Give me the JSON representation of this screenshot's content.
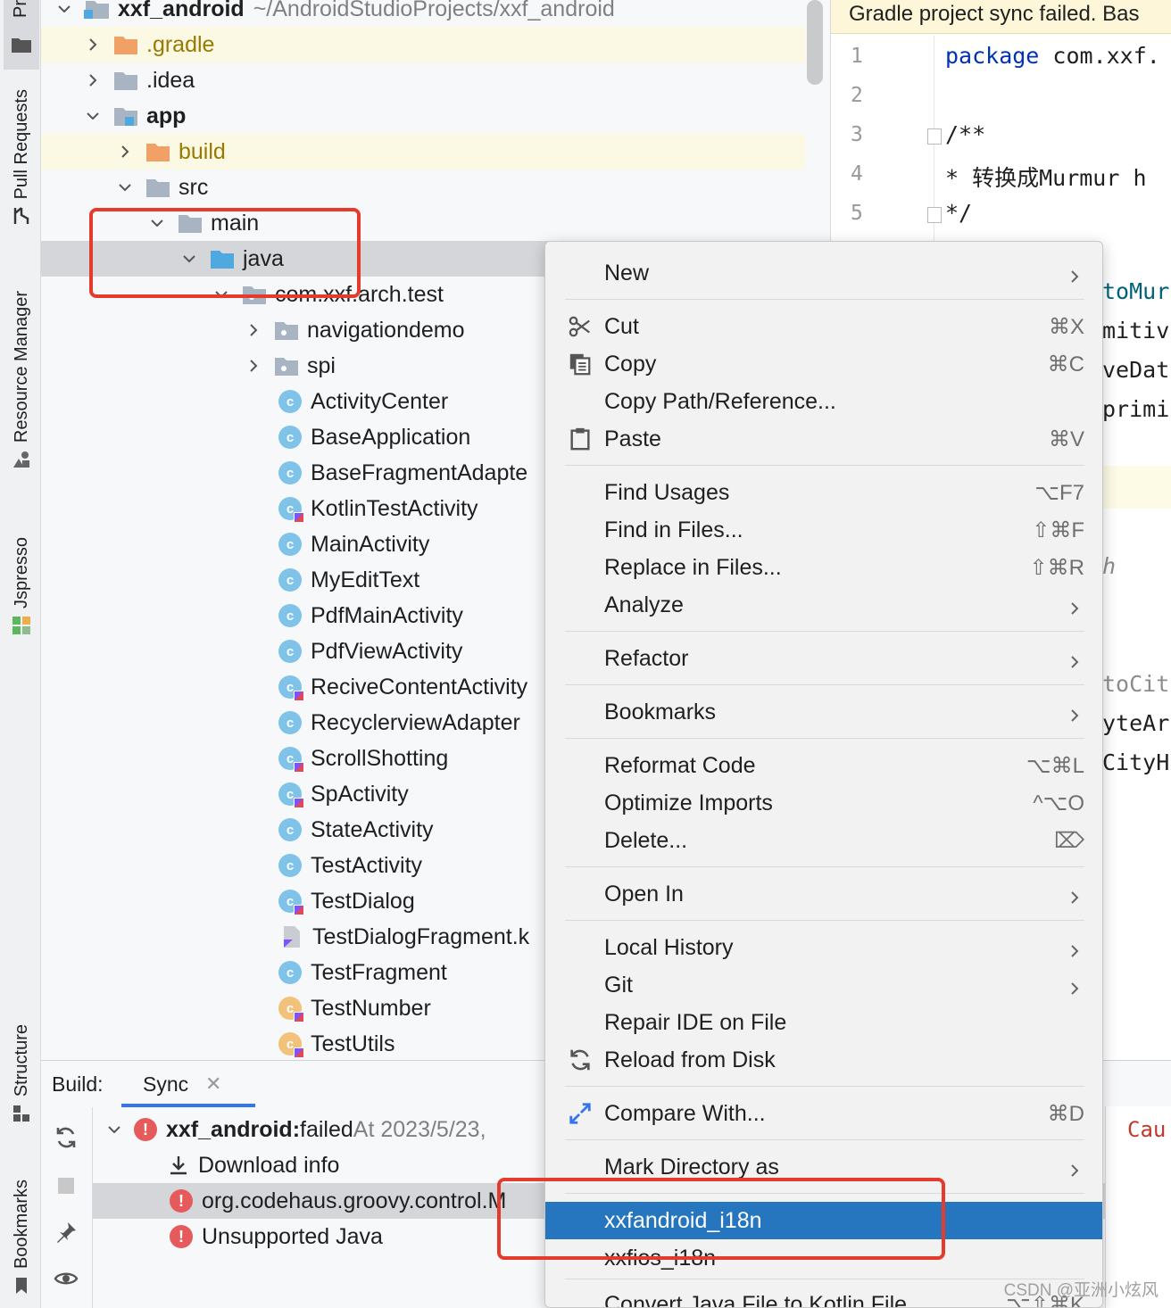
{
  "left_strip": {
    "project_label": "Pr",
    "pull_requests_label": "Pull Requests",
    "resource_manager_label": "Resource Manager",
    "jspresso_label": "Jspresso",
    "structure_label": "Structure",
    "bookmarks_label": "Bookmarks"
  },
  "tree": {
    "root": {
      "name": "xxf_android",
      "path": "~/AndroidStudioProjects/xxf_android"
    },
    "items": [
      {
        "label": ".gradle"
      },
      {
        "label": ".idea"
      },
      {
        "label": "app"
      },
      {
        "label": "build"
      },
      {
        "label": "src"
      },
      {
        "label": "main"
      },
      {
        "label": "java"
      },
      {
        "label": "com.xxf.arch.test"
      },
      {
        "label": "navigationdemo"
      },
      {
        "label": "spi"
      }
    ],
    "classes": [
      {
        "label": "ActivityCenter",
        "icon": "C",
        "kotlin": false,
        "orange": false
      },
      {
        "label": "BaseApplication",
        "icon": "C",
        "kotlin": false,
        "orange": false
      },
      {
        "label": "BaseFragmentAdapte",
        "icon": "C",
        "kotlin": false,
        "orange": false
      },
      {
        "label": "KotlinTestActivity",
        "icon": "C",
        "kotlin": true,
        "orange": false
      },
      {
        "label": "MainActivity",
        "icon": "C",
        "kotlin": false,
        "orange": false
      },
      {
        "label": "MyEditText",
        "icon": "C",
        "kotlin": false,
        "orange": false
      },
      {
        "label": "PdfMainActivity",
        "icon": "C",
        "kotlin": false,
        "orange": false
      },
      {
        "label": "PdfViewActivity",
        "icon": "C",
        "kotlin": false,
        "orange": false
      },
      {
        "label": "ReciveContentActivity",
        "icon": "C",
        "kotlin": true,
        "orange": false
      },
      {
        "label": "RecyclerviewAdapter",
        "icon": "C",
        "kotlin": false,
        "orange": false
      },
      {
        "label": "ScrollShotting",
        "icon": "C",
        "kotlin": true,
        "orange": false
      },
      {
        "label": "SpActivity",
        "icon": "C",
        "kotlin": true,
        "orange": false
      },
      {
        "label": "StateActivity",
        "icon": "C",
        "kotlin": false,
        "orange": false
      },
      {
        "label": "TestActivity",
        "icon": "C",
        "kotlin": false,
        "orange": false
      },
      {
        "label": "TestDialog",
        "icon": "C",
        "kotlin": true,
        "orange": false
      },
      {
        "label": "TestDialogFragment.k",
        "icon": "file",
        "kotlin": true,
        "orange": false
      },
      {
        "label": "TestFragment",
        "icon": "C",
        "kotlin": false,
        "orange": false
      },
      {
        "label": "TestNumber",
        "icon": "C",
        "kotlin": true,
        "orange": true
      },
      {
        "label": "TestUtils",
        "icon": "C",
        "kotlin": true,
        "orange": true
      }
    ]
  },
  "editor": {
    "banner": "Gradle project sync failed. Bas",
    "line_numbers": [
      "1",
      "2",
      "3",
      "4",
      "5"
    ],
    "lines": [
      {
        "kw": "package",
        "rest": " com.xxf."
      },
      {
        "kw": "",
        "rest": ""
      },
      {
        "kw": "",
        "rest": "/**"
      },
      {
        "kw": "",
        "rest": " * 转换成Murmur h"
      },
      {
        "kw": "",
        "rest": " */"
      }
    ],
    "fragments": [
      "toMur",
      "mitiv",
      "veDat",
      "primi",
      "h",
      "toCit",
      "yteAr",
      "CityH"
    ]
  },
  "context_menu": {
    "items": [
      {
        "label": "New",
        "shortcut": "",
        "submenu": true,
        "icon": ""
      },
      {
        "label": "Cut",
        "shortcut": "⌘X",
        "submenu": false,
        "icon": "scissors-icon"
      },
      {
        "label": "Copy",
        "shortcut": "⌘C",
        "submenu": false,
        "icon": "copy-icon"
      },
      {
        "label": "Copy Path/Reference...",
        "shortcut": "",
        "submenu": false,
        "icon": ""
      },
      {
        "label": "Paste",
        "shortcut": "⌘V",
        "submenu": false,
        "icon": "paste-icon"
      },
      {
        "label": "Find Usages",
        "shortcut": "⌥F7",
        "submenu": false,
        "icon": ""
      },
      {
        "label": "Find in Files...",
        "shortcut": "⇧⌘F",
        "submenu": false,
        "icon": ""
      },
      {
        "label": "Replace in Files...",
        "shortcut": "⇧⌘R",
        "submenu": false,
        "icon": ""
      },
      {
        "label": "Analyze",
        "shortcut": "",
        "submenu": true,
        "icon": ""
      },
      {
        "label": "Refactor",
        "shortcut": "",
        "submenu": true,
        "icon": ""
      },
      {
        "label": "Bookmarks",
        "shortcut": "",
        "submenu": true,
        "icon": ""
      },
      {
        "label": "Reformat Code",
        "shortcut": "⌥⌘L",
        "submenu": false,
        "icon": ""
      },
      {
        "label": "Optimize Imports",
        "shortcut": "^⌥O",
        "submenu": false,
        "icon": ""
      },
      {
        "label": "Delete...",
        "shortcut": "⌦",
        "submenu": false,
        "icon": ""
      },
      {
        "label": "Open In",
        "shortcut": "",
        "submenu": true,
        "icon": ""
      },
      {
        "label": "Local History",
        "shortcut": "",
        "submenu": true,
        "icon": ""
      },
      {
        "label": "Git",
        "shortcut": "",
        "submenu": true,
        "icon": ""
      },
      {
        "label": "Repair IDE on File",
        "shortcut": "",
        "submenu": false,
        "icon": ""
      },
      {
        "label": "Reload from Disk",
        "shortcut": "",
        "submenu": false,
        "icon": "reload-icon"
      },
      {
        "label": "Compare With...",
        "shortcut": "⌘D",
        "submenu": false,
        "icon": "compare-icon"
      },
      {
        "label": "Mark Directory as",
        "shortcut": "",
        "submenu": true,
        "icon": ""
      },
      {
        "label": "xxfandroid_i18n",
        "shortcut": "",
        "submenu": false,
        "icon": ""
      },
      {
        "label": "xxfios_i18n",
        "shortcut": "",
        "submenu": false,
        "icon": ""
      },
      {
        "label": "Convert Java File to Kotlin File",
        "shortcut": "⌥⇧⌘K",
        "submenu": false,
        "icon": ""
      }
    ]
  },
  "build_panel": {
    "label": "Build:",
    "tab": "Sync",
    "rows": [
      {
        "bold": "xxf_android:",
        "text": " failed",
        "muted": " At 2023/5/23,"
      },
      {
        "text": "Download info"
      },
      {
        "text": "org.codehaus.groovy.control.M"
      },
      {
        "text": "Unsupported Java"
      }
    ],
    "console_text": "Cau"
  },
  "watermark": "CSDN @亚洲小炫风",
  "colors": {
    "accent": "#2675bf",
    "annotation": "#e53b2c",
    "error": "#e55b5b",
    "folder": "#a8b4c2",
    "excluded_folder": "#f1a165",
    "source_folder": "#4fa8e0"
  }
}
